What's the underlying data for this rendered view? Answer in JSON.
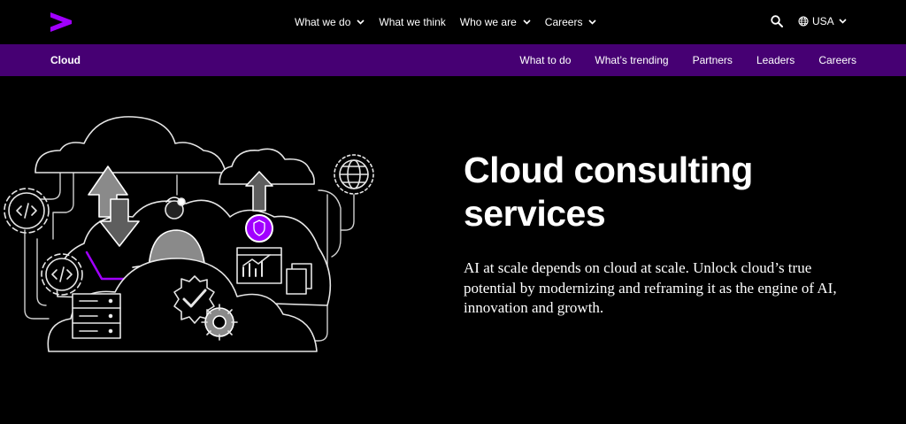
{
  "header": {
    "logo_icon": "accenture-chevron-logo-icon",
    "brand_color": "#A100FF",
    "nav": [
      {
        "label": "What we do",
        "has_dropdown": true
      },
      {
        "label": "What we think",
        "has_dropdown": false
      },
      {
        "label": "Who we are",
        "has_dropdown": true
      },
      {
        "label": "Careers",
        "has_dropdown": true
      }
    ],
    "search_icon": "search-icon",
    "locale": {
      "label": "USA",
      "icon": "globe-icon"
    }
  },
  "subnav": {
    "background": "#460073",
    "title": "Cloud",
    "items": [
      "What to do",
      "What’s trending",
      "Partners",
      "Leaders",
      "Careers"
    ]
  },
  "hero": {
    "title": "Cloud consulting services",
    "body": "AI at scale depends on cloud at scale. Unlock cloud’s true potential by modernizing and reframing it as the engine of AI, innovation and growth.",
    "illustration": "cloud-computing-illustration"
  }
}
